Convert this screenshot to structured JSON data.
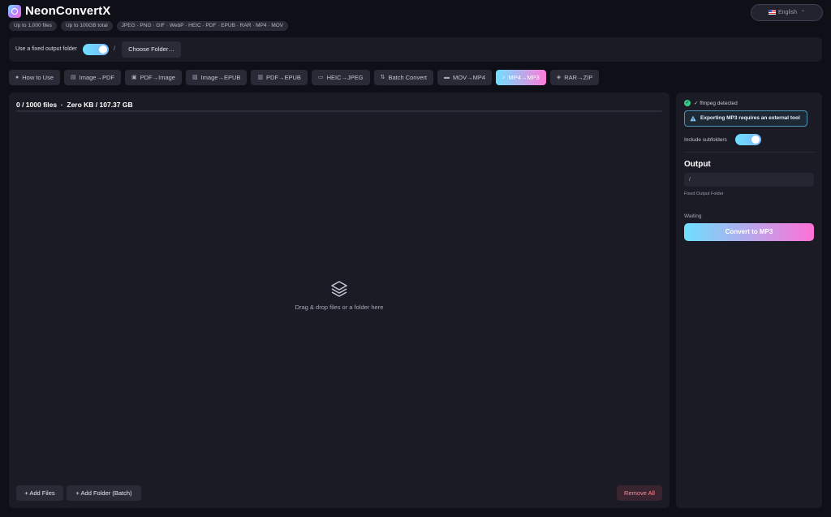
{
  "header": {
    "title": "NeonConvertX",
    "pills": [
      "Up to 1,000 files",
      "Up to 100GB total",
      "JPEG · PNG · GIF · WebP · HEIC · PDF · EPUB · RAR · MP4 · MOV"
    ],
    "language": "English"
  },
  "folder_bar": {
    "label": "Use a fixed output folder",
    "toggle_on": true,
    "separator": "/",
    "choose_label": "Choose Folder…"
  },
  "tabs": [
    {
      "label": "How to Use",
      "icon": "info-icon",
      "active": false
    },
    {
      "label": "Image→PDF",
      "icon": "document-icon",
      "active": false
    },
    {
      "label": "PDF→Image",
      "icon": "image-icon",
      "active": false
    },
    {
      "label": "Image→EPUB",
      "icon": "image-icon",
      "active": false
    },
    {
      "label": "PDF→EPUB",
      "icon": "book-icon",
      "active": false
    },
    {
      "label": "HEIC→JPEG",
      "icon": "picture-icon",
      "active": false
    },
    {
      "label": "Batch Convert",
      "icon": "batch-icon",
      "active": false
    },
    {
      "label": "MOV→MP4",
      "icon": "video-icon",
      "active": false
    },
    {
      "label": "MP4→MP3",
      "icon": "music-note-icon",
      "active": true
    },
    {
      "label": "RAR→ZIP",
      "icon": "archive-icon",
      "active": false
    }
  ],
  "main": {
    "files_count": "0 / 1000 files",
    "size_text": "Zero KB / 107.37 GB",
    "progress": 0,
    "drop_text": "Drag & drop files or a folder here",
    "add_files_label": "+ Add Files",
    "add_folder_label": "+ Add Folder (Batch)",
    "remove_all_label": "Remove All"
  },
  "side": {
    "ffmpeg_status": "✓ ffmpeg detected",
    "warning": "Exporting MP3 requires an external tool",
    "include_subfolders_label": "Include subfolders",
    "include_subfolders_on": true,
    "output_heading": "Output",
    "output_value": "/",
    "output_hint": "Fixed Output Folder",
    "status": "Waiting",
    "convert_label": "Convert to MP3"
  },
  "colors": {
    "accent_cyan": "#6ee0ff",
    "accent_pink": "#ff70d6",
    "success": "#38c98a",
    "danger": "#ff8a95"
  }
}
